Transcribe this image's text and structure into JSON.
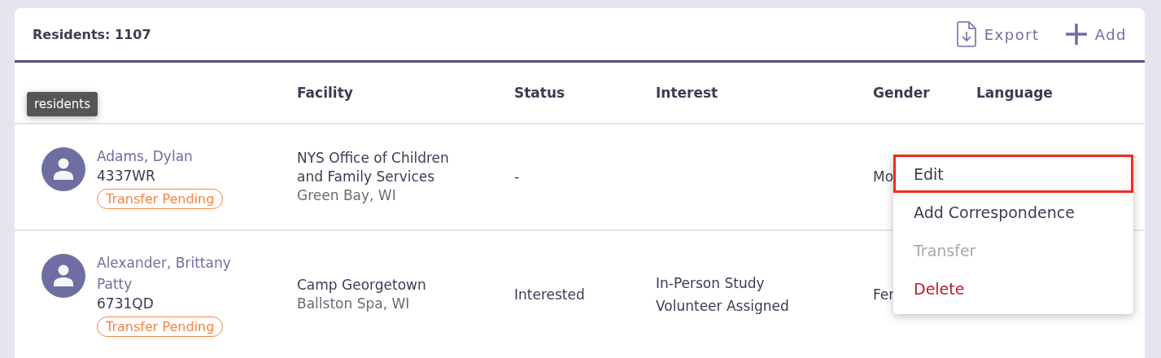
{
  "header": {
    "title": "Residents: 1107",
    "actions": [
      {
        "kind": "export",
        "label": "Export"
      },
      {
        "kind": "add",
        "label": "Add"
      }
    ]
  },
  "tooltip": "residents",
  "columns": [
    "Facility",
    "Status",
    "Interest",
    "Gender",
    "Language"
  ],
  "rows": [
    {
      "name": [
        "Adams, Dylan"
      ],
      "code": "4337WR",
      "badge": "Transfer Pending",
      "facility": [
        "NYS Office of Children",
        "and Family Services"
      ],
      "location": "Green Bay, WI",
      "status": "-",
      "interest": [],
      "gender": "Mo"
    },
    {
      "name": [
        "Alexander, Brittany",
        "Patty"
      ],
      "code": "6731QD",
      "badge": "Transfer Pending",
      "facility": [
        "Camp Georgetown"
      ],
      "location": "Ballston Spa, WI",
      "status": "Interested",
      "interest": [
        "In-Person Study",
        "Volunteer Assigned"
      ],
      "gender": "Fer"
    }
  ],
  "menu": [
    {
      "label": "Edit",
      "kind": "normal",
      "selected": true,
      "disabled": false
    },
    {
      "label": "Add Correspondence",
      "kind": "normal",
      "selected": false,
      "disabled": false
    },
    {
      "label": "Transfer",
      "kind": "normal",
      "selected": false,
      "disabled": true
    },
    {
      "label": "Delete",
      "kind": "danger",
      "selected": false,
      "disabled": false
    }
  ]
}
